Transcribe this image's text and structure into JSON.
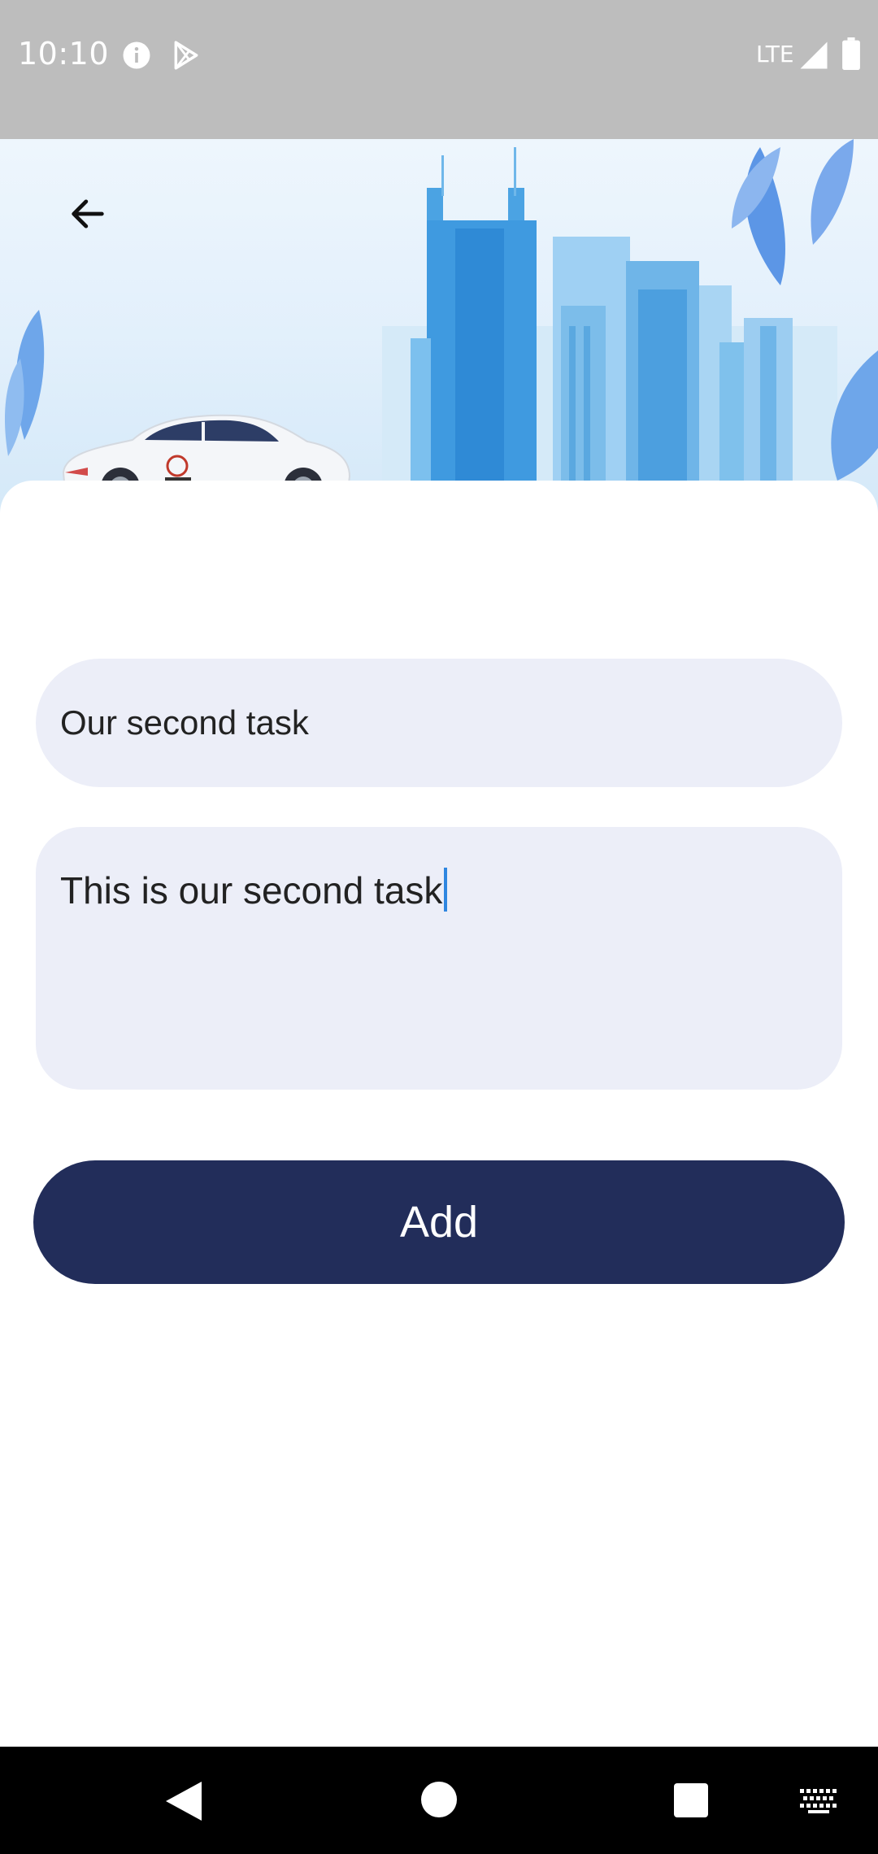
{
  "status_bar": {
    "time": "10:10",
    "network": "LTE",
    "icons": [
      "info-icon",
      "play-store-icon",
      "signal-icon",
      "battery-icon"
    ]
  },
  "header": {
    "back_icon": "arrow-back-icon",
    "illustration": "taxi-car-with-city-skyline"
  },
  "form": {
    "title_value": "Our second task",
    "description_value": "This is our second task",
    "submit_label": "Add"
  },
  "navigation_bar": {
    "icons": [
      "nav-back-icon",
      "nav-home-icon",
      "nav-recents-icon",
      "keyboard-icon"
    ]
  },
  "colors": {
    "status_bar": "#bdbdbd",
    "input_background": "#eceef8",
    "button_background": "#222d5a",
    "cursor": "#2f86e0"
  }
}
